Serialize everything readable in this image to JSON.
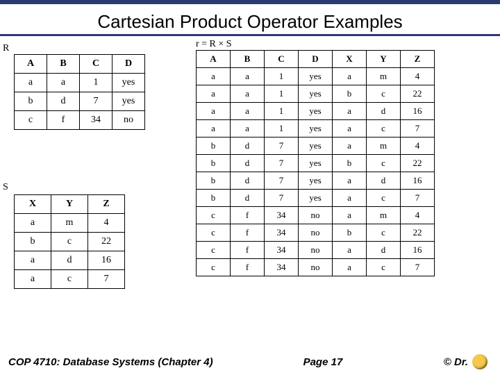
{
  "title": "Cartesian Product Operator Examples",
  "labels": {
    "R": "R",
    "S": "S",
    "r": "r = R × S"
  },
  "chart_data": [
    {
      "type": "table",
      "name": "R",
      "headers": [
        "A",
        "B",
        "C",
        "D"
      ],
      "rows": [
        [
          "a",
          "a",
          "1",
          "yes"
        ],
        [
          "b",
          "d",
          "7",
          "yes"
        ],
        [
          "c",
          "f",
          "34",
          "no"
        ]
      ]
    },
    {
      "type": "table",
      "name": "S",
      "headers": [
        "X",
        "Y",
        "Z"
      ],
      "rows": [
        [
          "a",
          "m",
          "4"
        ],
        [
          "b",
          "c",
          "22"
        ],
        [
          "a",
          "d",
          "16"
        ],
        [
          "a",
          "c",
          "7"
        ]
      ]
    },
    {
      "type": "table",
      "name": "r",
      "title": "r = R × S",
      "headers": [
        "A",
        "B",
        "C",
        "D",
        "X",
        "Y",
        "Z"
      ],
      "rows": [
        [
          "a",
          "a",
          "1",
          "yes",
          "a",
          "m",
          "4"
        ],
        [
          "a",
          "a",
          "1",
          "yes",
          "b",
          "c",
          "22"
        ],
        [
          "a",
          "a",
          "1",
          "yes",
          "a",
          "d",
          "16"
        ],
        [
          "a",
          "a",
          "1",
          "yes",
          "a",
          "c",
          "7"
        ],
        [
          "b",
          "d",
          "7",
          "yes",
          "a",
          "m",
          "4"
        ],
        [
          "b",
          "d",
          "7",
          "yes",
          "b",
          "c",
          "22"
        ],
        [
          "b",
          "d",
          "7",
          "yes",
          "a",
          "d",
          "16"
        ],
        [
          "b",
          "d",
          "7",
          "yes",
          "a",
          "c",
          "7"
        ],
        [
          "c",
          "f",
          "34",
          "no",
          "a",
          "m",
          "4"
        ],
        [
          "c",
          "f",
          "34",
          "no",
          "b",
          "c",
          "22"
        ],
        [
          "c",
          "f",
          "34",
          "no",
          "a",
          "d",
          "16"
        ],
        [
          "c",
          "f",
          "34",
          "no",
          "a",
          "c",
          "7"
        ]
      ]
    }
  ],
  "footer": {
    "course": "COP 4710: Database Systems  (Chapter 4)",
    "page": "Page 17",
    "copyright": "© Dr."
  }
}
